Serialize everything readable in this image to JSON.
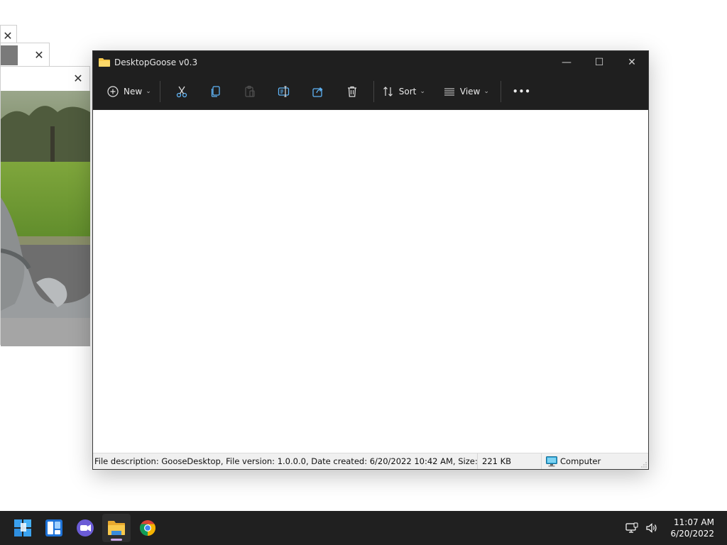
{
  "background_windows": {
    "close_glyph": "✕"
  },
  "explorer": {
    "title": "DesktopGoose v0.3",
    "window_controls": {
      "minimize": "—",
      "maximize": "☐",
      "close": "✕"
    },
    "toolbar": {
      "new_label": "New",
      "sort_label": "Sort",
      "view_label": "View",
      "more_label": "•••",
      "icons": [
        "cut-icon",
        "copy-icon",
        "paste-icon",
        "rename-icon",
        "share-icon",
        "delete-icon"
      ]
    },
    "status": {
      "description": "File description: GooseDesktop, File version: 1.0.0.0, Date created: 6/20/2022 10:42 AM, Size: 221 KB",
      "size": "221 KB",
      "zone": "Computer"
    }
  },
  "taskbar": {
    "apps": [
      "start-icon",
      "widgets-icon",
      "chat-icon",
      "file-explorer-icon",
      "chrome-icon"
    ],
    "active_app": "file-explorer-icon",
    "time": "11:07 AM",
    "date": "6/20/2022"
  },
  "colors": {
    "titlebar": "#1f1f1f",
    "taskbar": "#202020",
    "statusbar": "#f0f0f0",
    "folder": "#f8c94c",
    "accent_blue": "#4aa3f0"
  }
}
